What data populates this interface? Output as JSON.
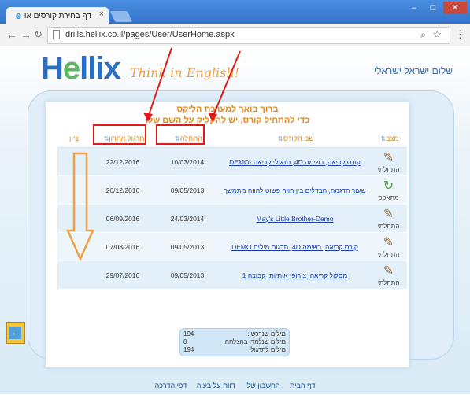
{
  "browser": {
    "tab_title": "דף בחירת קורסים או מ",
    "url": "drills.hellix.co.il/pages/User/UserHome.aspx"
  },
  "header": {
    "logo": "Hellix",
    "tagline": "Think in English!",
    "greeting": "שלום ישראל ישראלי"
  },
  "welcome": {
    "line1": "ברוך בואך למערכת הליקס",
    "line2": "כדי להתחיל קורס, יש להקליק על השם שלו"
  },
  "table": {
    "headers": {
      "status": "מצב",
      "course": "שם הקורס",
      "start": "התחלה",
      "last_practice": "תרגול אחרון",
      "grade": "ציון"
    },
    "rows": [
      {
        "status": "התחלתי",
        "course": "קורס קריאה, רשימה 4D, תרגילי קריאה -DEMO",
        "start": "10/03/2014",
        "last": "22/12/2016",
        "grade": ""
      },
      {
        "status": "מתאפס",
        "course": "שעור הדגמה, הבדלים בין הווה פשוט להווה מתמשך",
        "start": "09/05/2013",
        "last": "20/12/2016",
        "grade": ""
      },
      {
        "status": "התחלתי",
        "course": "May's Little Brother-Demo",
        "start": "24/03/2014",
        "last": "06/09/2016",
        "grade": ""
      },
      {
        "status": "התחלתי",
        "course": "קורס קריאה, רשימה 4D, תרגום מילים DEMO",
        "start": "09/05/2013",
        "last": "07/08/2016",
        "grade": ""
      },
      {
        "status": "התחלתי",
        "course": "מסלול קריאה, צירופי אותיות, קבוצה 1",
        "start": "09/05/2013",
        "last": "29/07/2016",
        "grade": ""
      }
    ]
  },
  "stats": {
    "rows": [
      {
        "label": "מילים שנרכשו:",
        "value": "194"
      },
      {
        "label": "מילים שנלמדו בהצלחה:",
        "value": "0"
      },
      {
        "label": "מילים לתרגול:",
        "value": "194"
      }
    ]
  },
  "footer": {
    "links": [
      "דף הבית",
      "החשבון שלי",
      "דווח על בעיה",
      "דפי הדרכה"
    ]
  },
  "colors": {
    "accent": "#e08a1e",
    "link": "#1a3cab",
    "highlight": "#e31a1a"
  }
}
